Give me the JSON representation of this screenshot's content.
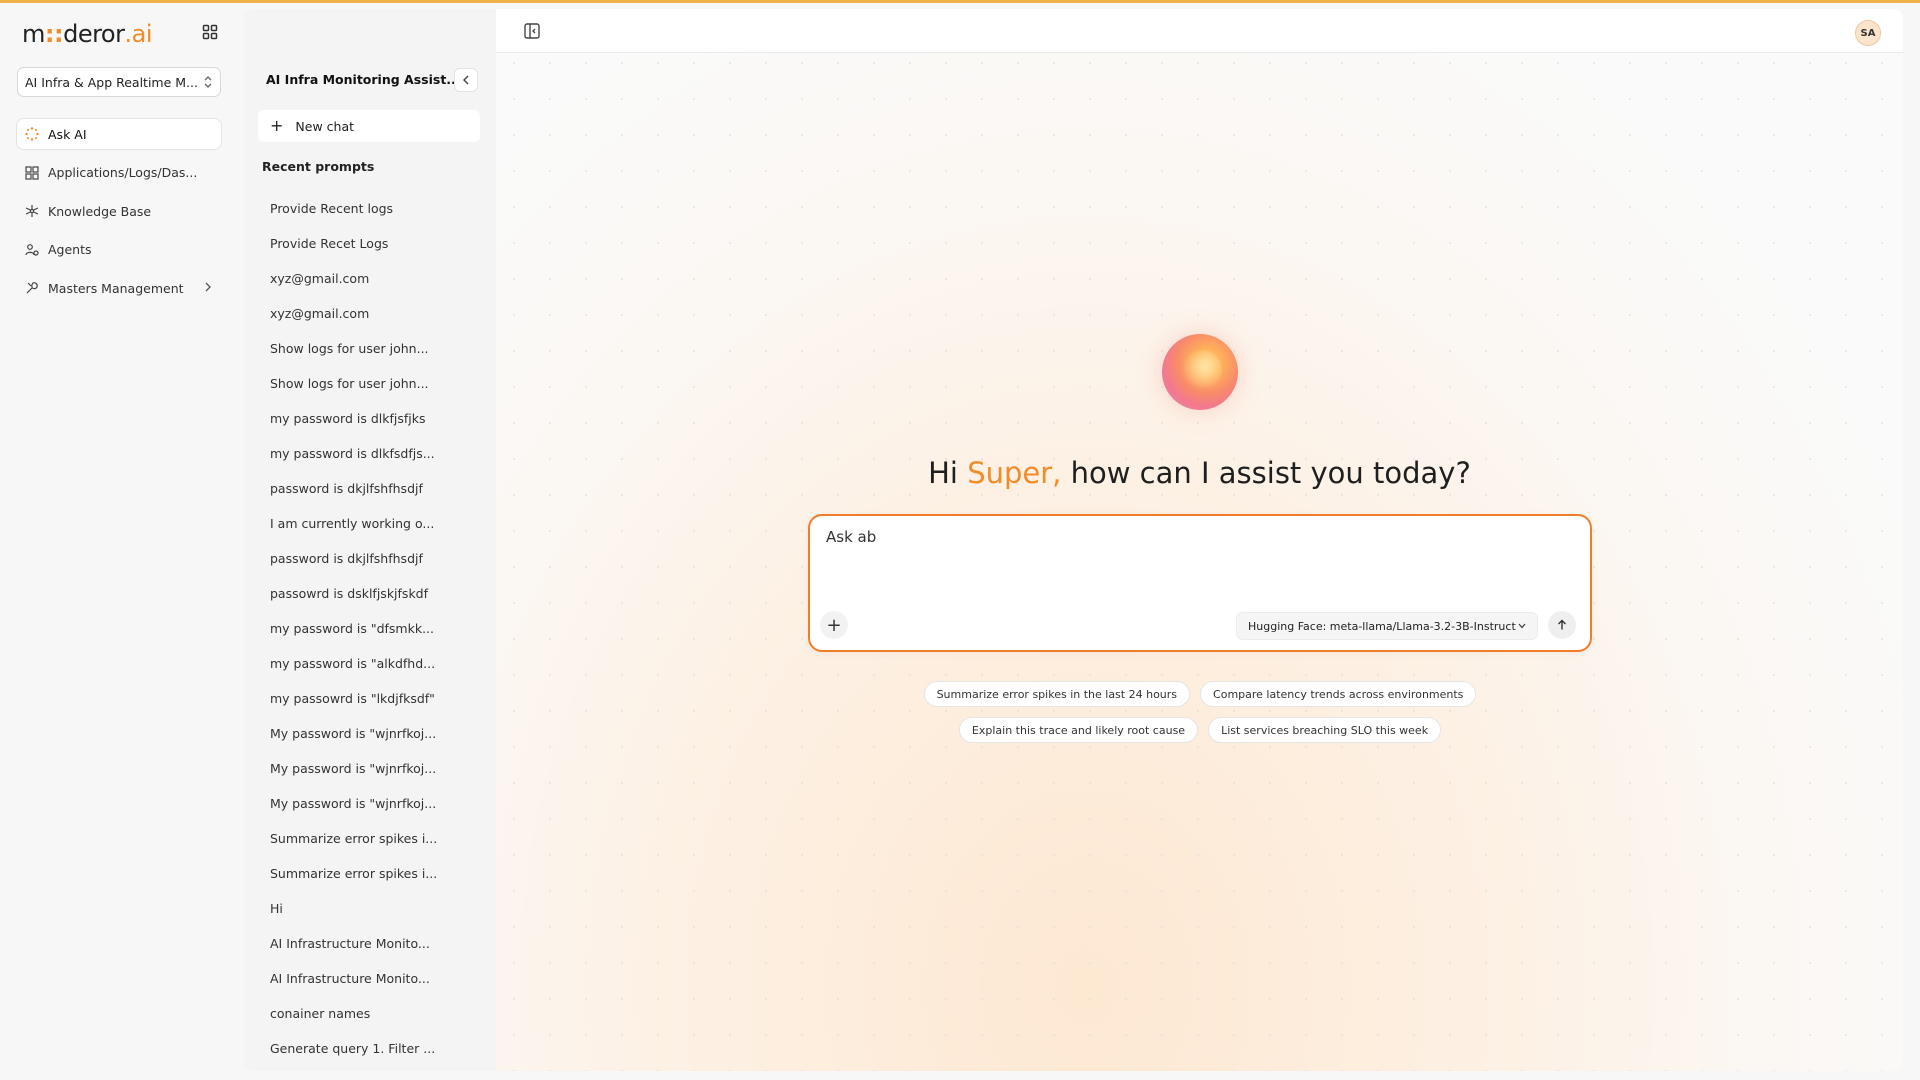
{
  "brand": {
    "part1": "m",
    "dots": "::",
    "part2": "deror",
    "part3": ".ai"
  },
  "project": {
    "selected": "AI Infra & App Realtime M..."
  },
  "nav": {
    "items": [
      {
        "label": "Ask AI",
        "icon": "sparkle-icon",
        "active": true
      },
      {
        "label": "Applications/Logs/Das...",
        "icon": "dashboard-grid-icon"
      },
      {
        "label": "Knowledge Base",
        "icon": "network-icon"
      },
      {
        "label": "Agents",
        "icon": "agents-icon"
      },
      {
        "label": "Masters Management",
        "icon": "wrench-icon"
      }
    ]
  },
  "chats": {
    "title": "AI Infra Monitoring Assist...",
    "new_chat": "New chat",
    "recent_heading": "Recent prompts",
    "recent": [
      "Provide Recent logs",
      "Provide Recet Logs",
      "xyz@gmail.com",
      "xyz@gmail.com",
      "Show logs for user john...",
      "Show logs for user john...",
      "my password is dlkfjsfjks",
      "my password is dlkfsdfjs...",
      "password is dkjlfshfhsdjf",
      "I am currently working o...",
      "password is dkjlfshfhsdjf",
      "passowrd is dsklfjskjfskdf",
      "my password is \"dfsmkk...",
      "my password is \"alkdfhd...",
      "my passowrd is \"lkdjfksdf\"",
      "My password is \"wjnrfkoj...",
      "My password is \"wjnrfkoj...",
      "My password is \"wjnrfkoj...",
      "Summarize error spikes i...",
      "Summarize error spikes i...",
      "Hi",
      "AI Infrastructure Monito...",
      "AI Infrastructure Monito...",
      "conainer names",
      "Generate query 1. Filter ..."
    ]
  },
  "header": {
    "avatar": "SA"
  },
  "main": {
    "greeting_prefix": "Hi ",
    "greeting_name": "Super,",
    "greeting_suffix": " how can I assist you today?",
    "input_value": "Ask ab",
    "model": "Hugging Face: meta-llama/Llama-3.2-3B-Instruct",
    "suggestions": [
      "Summarize error spikes in the last 24 hours",
      "Compare latency trends across environments",
      "Explain this trace and likely root cause",
      "List services breaching SLO this week"
    ]
  },
  "colors": {
    "accent": "#f28c28",
    "border_accent": "#f07d2a",
    "topline": "#f2b24a"
  }
}
